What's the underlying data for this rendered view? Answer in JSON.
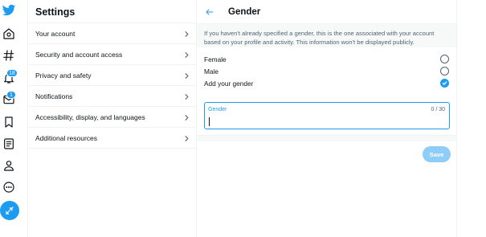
{
  "rail": {
    "notifications_badge": "18",
    "messages_badge": "1"
  },
  "settings": {
    "title": "Settings",
    "items": [
      {
        "label": "Your account"
      },
      {
        "label": "Security and account access"
      },
      {
        "label": "Privacy and safety"
      },
      {
        "label": "Notifications"
      },
      {
        "label": "Accessibility, display, and languages"
      },
      {
        "label": "Additional resources"
      }
    ]
  },
  "detail": {
    "title": "Gender",
    "description": "If you haven't already specified a gender, this is the one associated with your account based on your profile and activity. This information won't be displayed publicly.",
    "options": [
      {
        "label": "Female",
        "checked": false
      },
      {
        "label": "Male",
        "checked": false
      },
      {
        "label": "Add your gender",
        "checked": true
      }
    ],
    "field": {
      "label": "Gender",
      "counter": "0 / 30",
      "value": ""
    },
    "save_label": "Save"
  },
  "colors": {
    "accent": "#1d9bf0",
    "save_disabled": "#8ecdf8",
    "text_primary": "#0f1419",
    "text_secondary": "#536471"
  }
}
